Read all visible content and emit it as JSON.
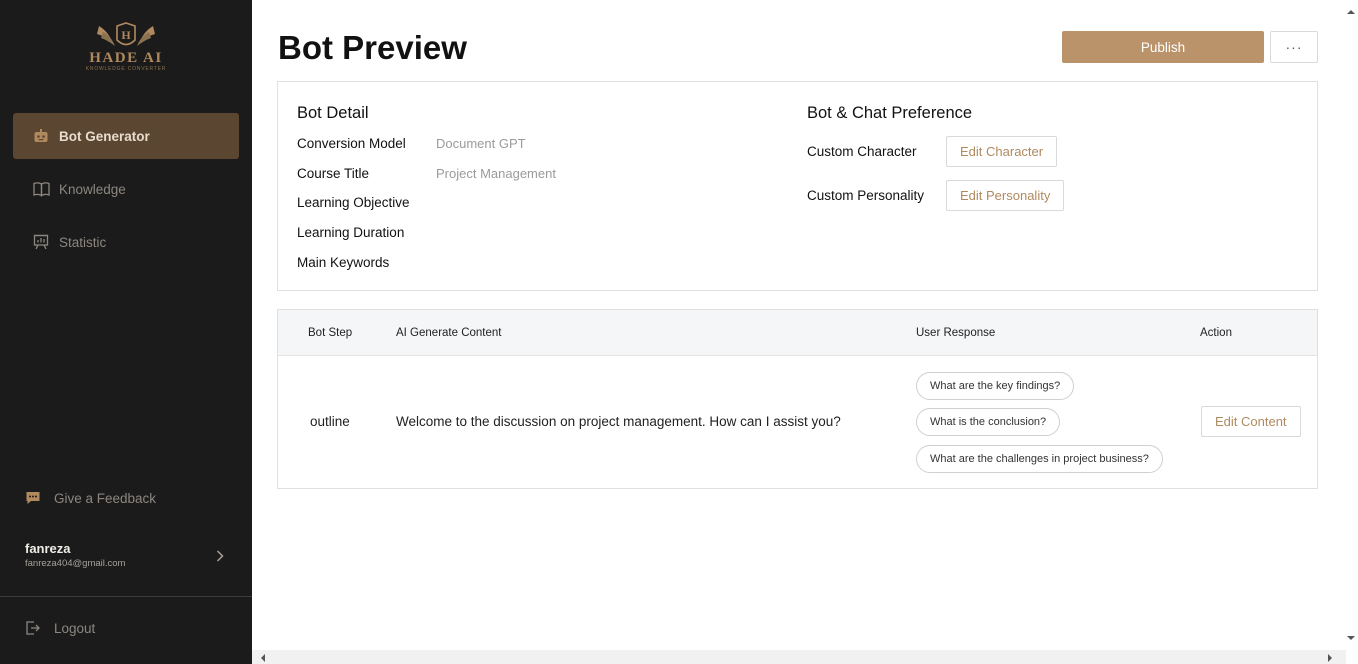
{
  "brand": {
    "name": "HADE AI",
    "tagline": "KNOWLEDGE CONVERTER",
    "accent": "#bb936b",
    "sidebar_bg": "#1b1b1b",
    "active_bg": "#5b4631"
  },
  "sidebar": {
    "items": [
      {
        "label": "Bot Generator",
        "icon": "robot-icon",
        "active": true
      },
      {
        "label": "Knowledge",
        "icon": "book-icon",
        "active": false
      },
      {
        "label": "Statistic",
        "icon": "presentation-chart-icon",
        "active": false
      }
    ],
    "feedback_label": "Give a Feedback",
    "user": {
      "name": "fanreza",
      "email": "fanreza404@gmail.com"
    },
    "logout_label": "Logout"
  },
  "header": {
    "title": "Bot Preview",
    "publish_label": "Publish",
    "more_label": "···"
  },
  "bot_detail": {
    "title": "Bot Detail",
    "fields": [
      {
        "label": "Conversion Model",
        "value": "Document GPT"
      },
      {
        "label": "Course Title",
        "value": "Project Management"
      },
      {
        "label": "Learning Objective",
        "value": ""
      },
      {
        "label": "Learning Duration",
        "value": ""
      },
      {
        "label": "Main Keywords",
        "value": ""
      }
    ]
  },
  "preference": {
    "title": "Bot & Chat Preference",
    "rows": [
      {
        "label": "Custom Character",
        "button": "Edit Character"
      },
      {
        "label": "Custom Personality",
        "button": "Edit Personality"
      }
    ]
  },
  "table": {
    "headers": [
      "Bot Step",
      "AI Generate Content",
      "User Response",
      "Action"
    ],
    "rows": [
      {
        "step": "outline",
        "content": "Welcome to the discussion on project management. How can I assist you?",
        "responses": [
          "What are the key findings?",
          "What is the conclusion?",
          "What are the challenges in project business?"
        ],
        "action": "Edit Content"
      }
    ]
  }
}
